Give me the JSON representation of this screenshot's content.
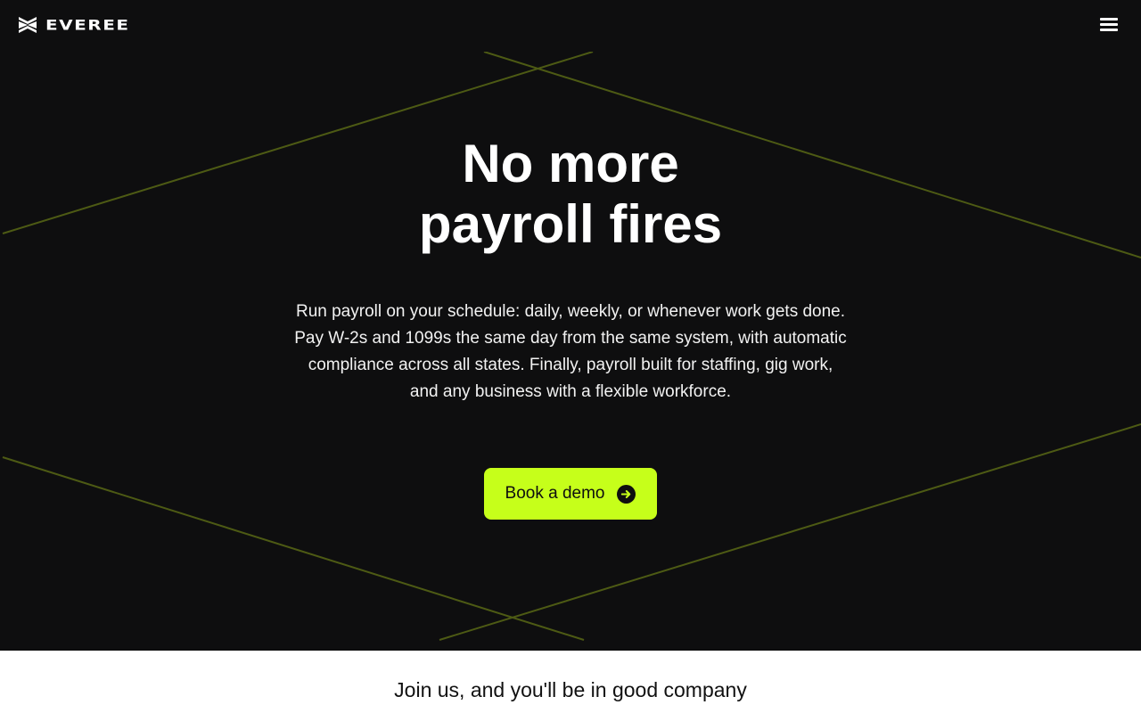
{
  "header": {
    "brand": "EVEREE",
    "logo_icon": "everee-mark-icon",
    "menu_icon": "hamburger-menu-icon"
  },
  "hero": {
    "title_line1": "No more",
    "title_line2": "payroll fires",
    "description": "Run payroll on your schedule: daily, weekly, or whenever work gets done. Pay W-2s and 1099s the same day from the same system, with automatic compliance across all states. Finally, payroll built for staffing, gig work, and any business with a flexible workforce.",
    "cta_label": "Book a demo",
    "cta_icon": "arrow-right-circle-icon"
  },
  "company": {
    "title": "Join us, and you'll be in good company"
  },
  "colors": {
    "background": "#0e0e0f",
    "accent": "#c6ff1a",
    "text": "#ffffff",
    "section_light": "#ffffff"
  }
}
